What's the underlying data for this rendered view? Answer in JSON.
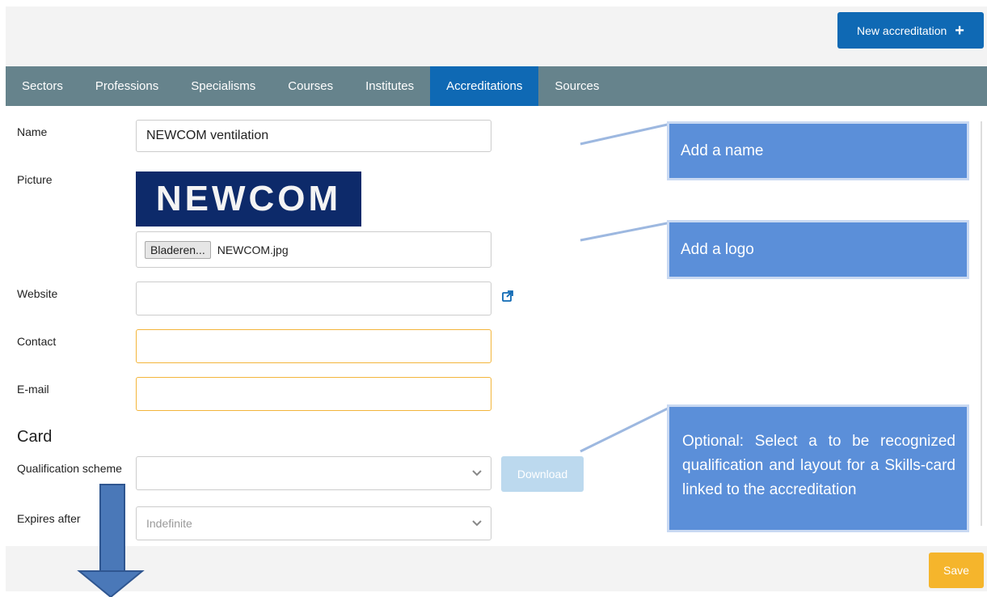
{
  "header": {
    "new_button_label": "New accreditation",
    "plus_icon": "+"
  },
  "tabs": [
    {
      "label": "Sectors"
    },
    {
      "label": "Professions"
    },
    {
      "label": "Specialisms"
    },
    {
      "label": "Courses"
    },
    {
      "label": "Institutes"
    },
    {
      "label": "Accreditations",
      "active": true
    },
    {
      "label": "Sources"
    }
  ],
  "form": {
    "name_label": "Name",
    "name_value": "NEWCOM ventilation",
    "picture_label": "Picture",
    "logo_text": "NEWCOM",
    "file_button": "Bladeren...",
    "file_name": "NEWCOM.jpg",
    "website_label": "Website",
    "website_value": "",
    "contact_label": "Contact",
    "contact_value": "",
    "email_label": "E-mail",
    "email_value": ""
  },
  "card": {
    "title": "Card",
    "qualification_label": "Qualification scheme",
    "qualification_value": "",
    "download_label": "Download",
    "expires_label": "Expires after",
    "expires_value": "Indefinite"
  },
  "footer": {
    "save_label": "Save"
  },
  "annotations": {
    "name_hint": "Add a name",
    "logo_hint": "Add a logo",
    "card_hint": "Optional: Select a to be recognized qualification and layout for a Skills-card linked to the accreditation"
  },
  "colors": {
    "primary": "#0f69b4",
    "nav": "#66838c",
    "warning": "#f5b52c",
    "callout": "#5b8fd9"
  }
}
